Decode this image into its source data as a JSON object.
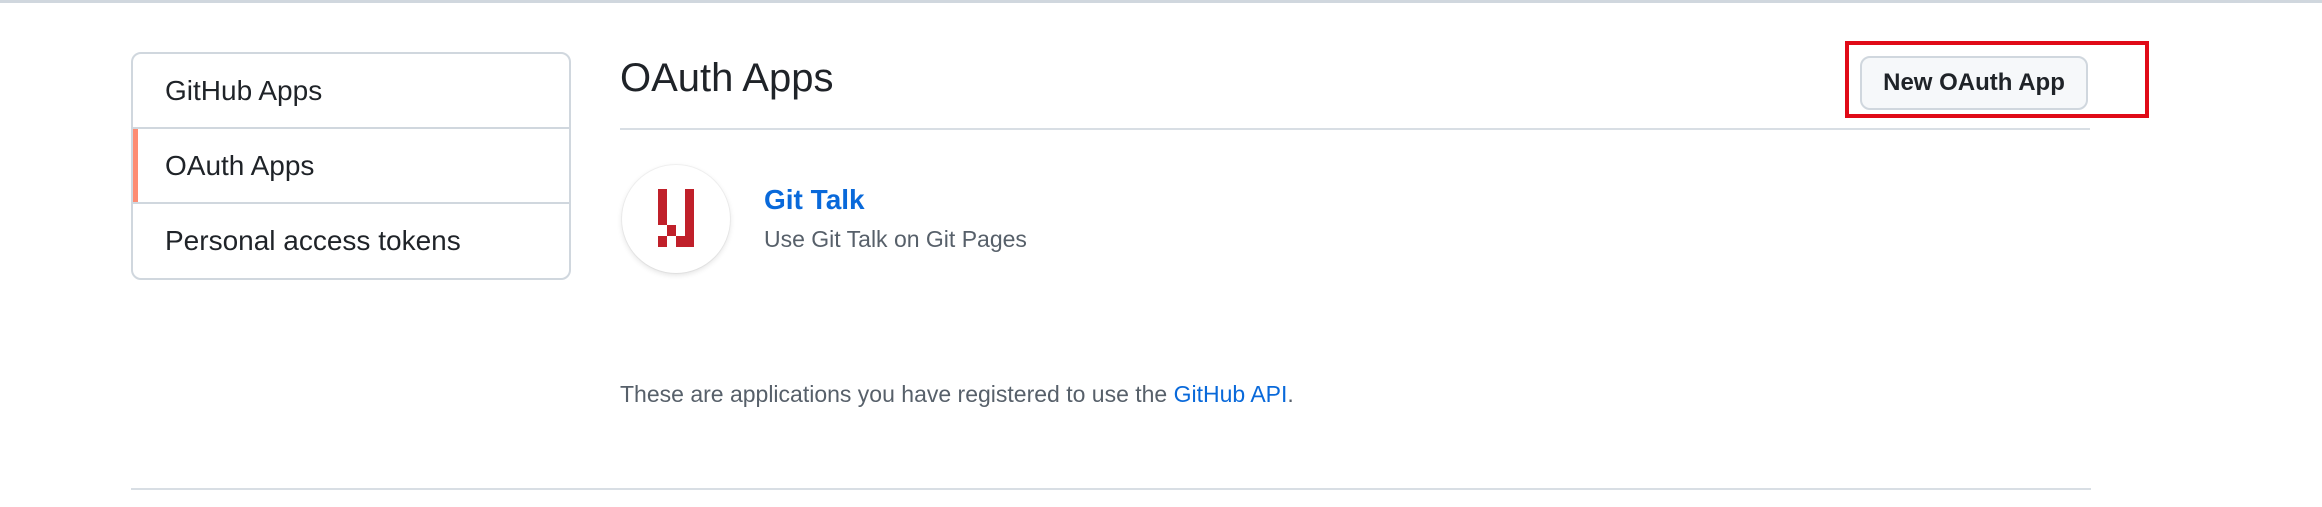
{
  "sidebar": {
    "items": [
      {
        "label": "GitHub Apps",
        "selected": false
      },
      {
        "label": "OAuth Apps",
        "selected": true
      },
      {
        "label": "Personal access tokens",
        "selected": false
      }
    ],
    "selected_accent_color": "#fd8c73"
  },
  "main": {
    "title": "OAuth Apps",
    "new_app_button_label": "New OAuth App",
    "highlight_color": "#e00a17",
    "apps": [
      {
        "name": "Git Talk",
        "description": "Use Git Talk on Git Pages",
        "avatar_icon": "gitalk-logo-icon",
        "avatar_color": "#c0202a"
      }
    ],
    "footer": {
      "text_before": "These are applications you have registered to use the ",
      "link_text": "GitHub API",
      "text_after": "."
    }
  },
  "colors": {
    "link": "#0969da",
    "text": "#1f2328",
    "muted": "#57606a",
    "border": "#d0d7de"
  }
}
